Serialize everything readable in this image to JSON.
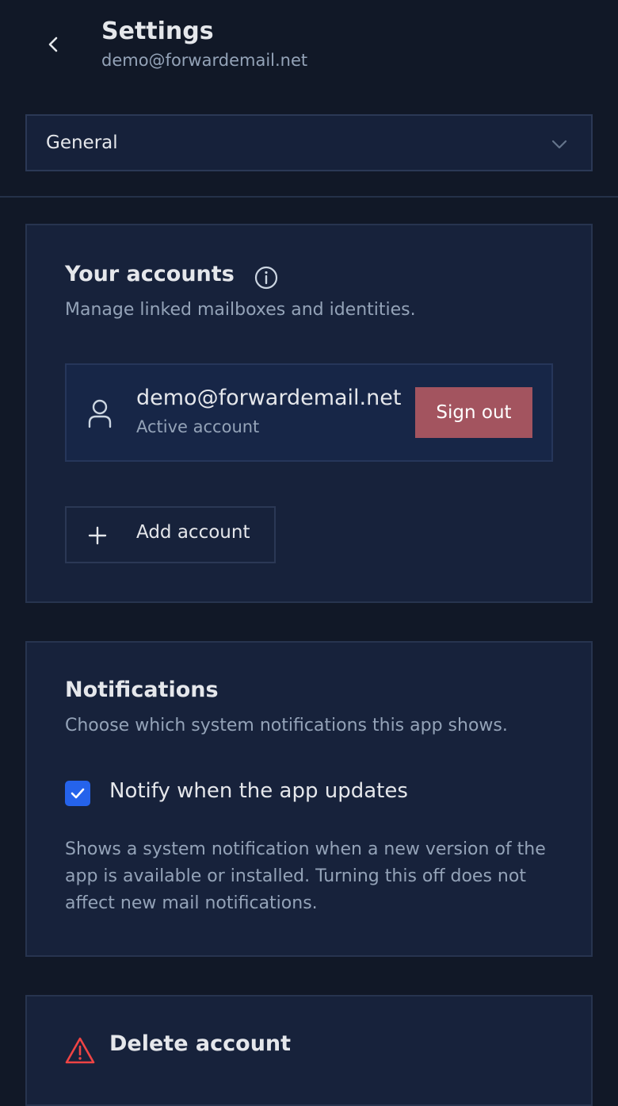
{
  "header": {
    "title": "Settings",
    "subtitle": "demo@forwardemail.net",
    "back_icon": "chevron-left-icon"
  },
  "section_select": {
    "value": "General",
    "icon": "chevron-down-icon"
  },
  "accounts_card": {
    "title": "Your accounts",
    "info_icon": "info-icon",
    "description": "Manage linked mailboxes and identities.",
    "account": {
      "email": "demo@forwardemail.net",
      "status": "Active account",
      "icon": "person-icon",
      "sign_out_label": "Sign out"
    },
    "add_account_label": "Add account"
  },
  "notifications_card": {
    "title": "Notifications",
    "description": "Choose which system notifications this app shows.",
    "checkbox_label": "Notify when the app updates",
    "checked": true,
    "help_text": "Shows a system notification when a new version of the app is available or installed. Turning this off does not affect new mail notifications."
  },
  "danger_card": {
    "title": "Delete account",
    "icon": "warning-icon"
  },
  "colors": {
    "background": "#111827",
    "card": "#17223b",
    "accent": "#2563eb",
    "danger": "#a3545f",
    "warning": "#ef4444"
  }
}
